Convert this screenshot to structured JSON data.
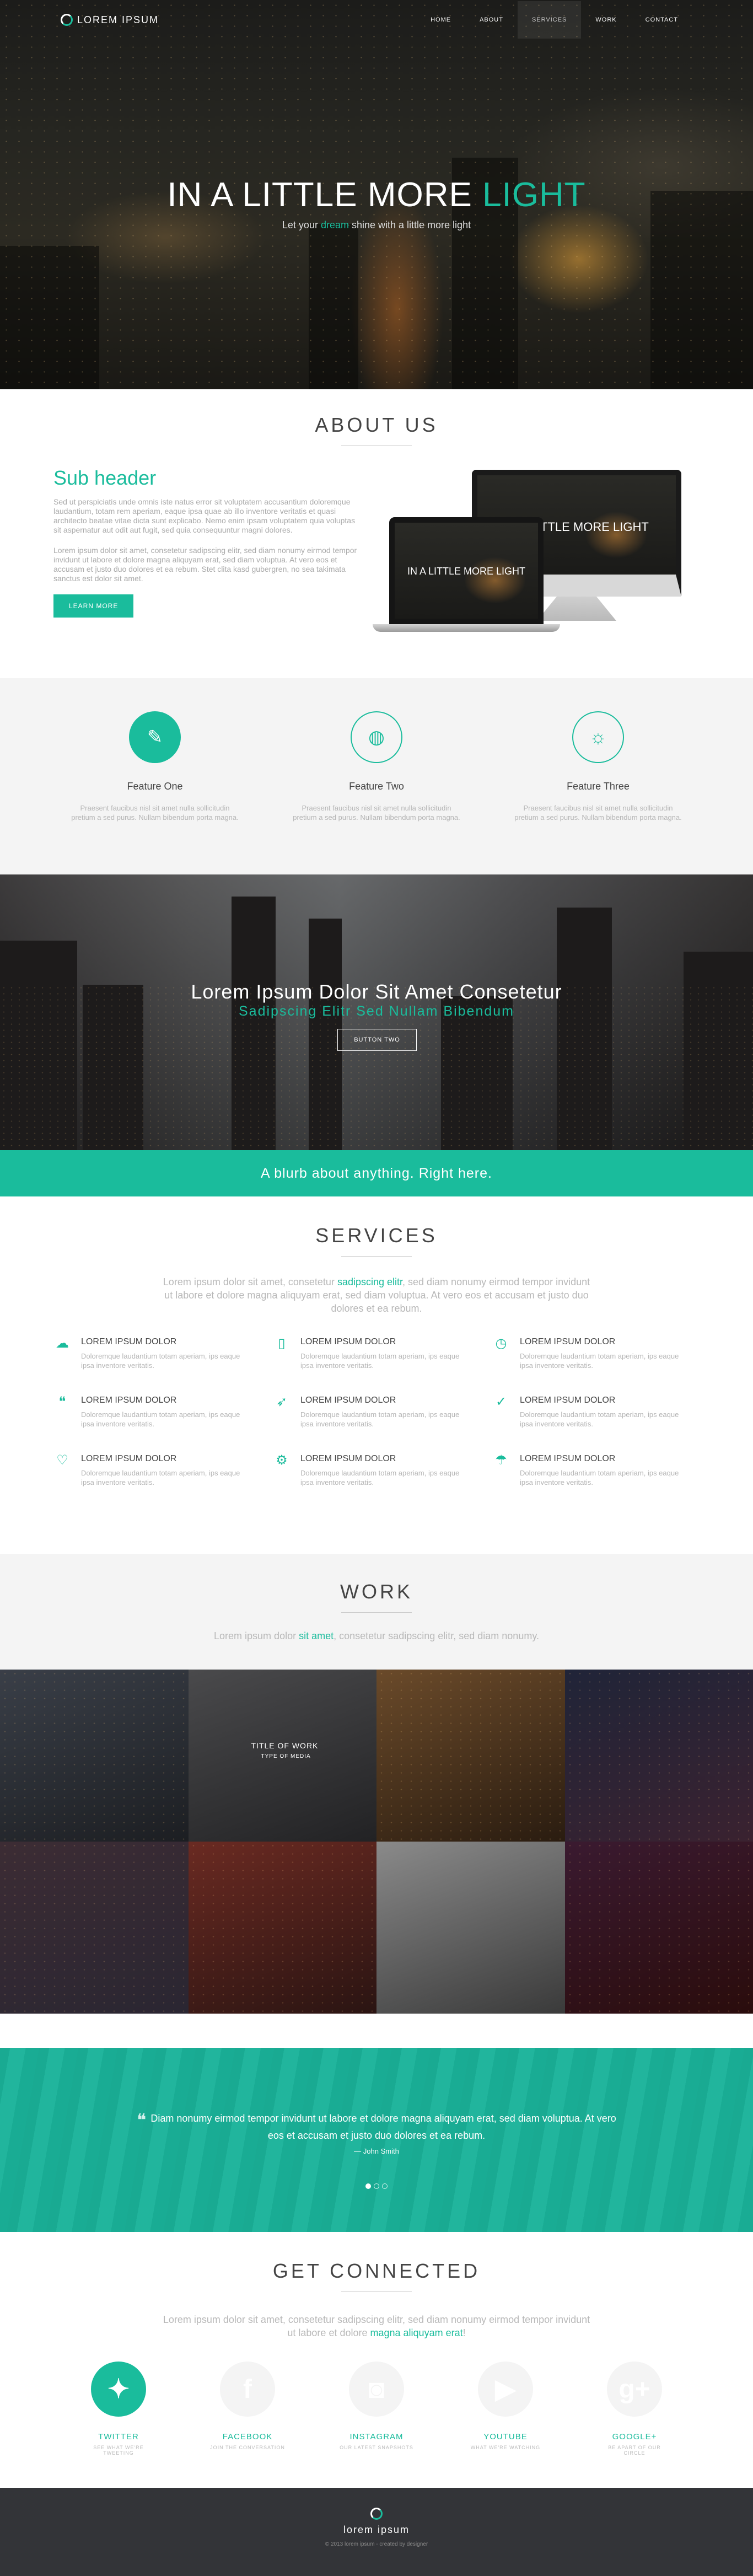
{
  "brand": {
    "name": "LOREM IPSUM",
    "accent": "#1abc9c",
    "dark": "#333438"
  },
  "nav": {
    "items": [
      {
        "label": "HOME"
      },
      {
        "label": "ABOUT"
      },
      {
        "label": "SERVICES"
      },
      {
        "label": "WORK"
      },
      {
        "label": "CONTACT"
      }
    ],
    "active": "SERVICES"
  },
  "hero": {
    "title_main": "IN A LITTLE MORE ",
    "title_accent": "LIGHT",
    "sub_pre": "Let your ",
    "sub_accent": "dream",
    "sub_post": " shine with a little more light"
  },
  "about": {
    "title": "ABOUT US",
    "subheader": "Sub header",
    "p1": "Sed ut perspiciatis unde omnis iste natus error sit voluptatem accusantium doloremque laudantium, totam rem aperiam, eaque ipsa quae ab illo inventore veritatis et quasi architecto beatae vitae dicta sunt explicabo. Nemo enim ipsam voluptatem quia voluptas sit aspernatur aut odit aut fugit, sed quia consequuntur magni dolores.",
    "p2": "Lorem ipsum dolor sit amet, consetetur sadipscing elitr, sed diam nonumy eirmod tempor invidunt ut labore et dolore magna aliquyam erat, sed diam voluptua. At vero eos et accusam et justo duo dolores et ea rebum. Stet clita kasd gubergren, no sea takimata sanctus est dolor sit amet.",
    "button": "LEARN MORE",
    "screen_text": "IN A LITTLE MORE LIGHT"
  },
  "features": [
    {
      "icon": "brush-icon",
      "glyph": "✎",
      "title": "Feature One",
      "text": "Praesent faucibus nisl sit amet nulla sollicitudin pretium a sed purus. Nullam bibendum porta magna."
    },
    {
      "icon": "globe-icon",
      "glyph": "◍",
      "title": "Feature Two",
      "text": "Praesent faucibus nisl sit amet nulla sollicitudin pretium a sed purus. Nullam bibendum porta magna."
    },
    {
      "icon": "lightbulb-icon",
      "glyph": "☼",
      "title": "Feature Three",
      "text": "Praesent faucibus nisl sit amet nulla sollicitudin pretium a sed purus. Nullam bibendum porta magna."
    }
  ],
  "banner": {
    "title": "Lorem Ipsum Dolor Sit Amet Consetetur",
    "subtitle": "Sadipscing Elitr Sed Nullam Bibendum",
    "button": "BUTTON TWO"
  },
  "blurb": "A blurb about anything. Right here.",
  "services": {
    "title": "SERVICES",
    "lead_pre": "Lorem ipsum dolor sit amet, consetetur ",
    "lead_accent": "sadipscing elitr",
    "lead_post": ", sed diam nonumy eirmod tempor invidunt ut labore et dolore magna aliquyam erat, sed diam voluptua. At vero eos et accusam et justo duo dolores et ea rebum.",
    "items": [
      {
        "icon": "cloud-upload-icon",
        "glyph": "☁",
        "title": "LOREM IPSUM DOLOR",
        "text": "Doloremque laudantium totam aperiam, ips eaque ipsa inventore veritatis."
      },
      {
        "icon": "mobile-icon",
        "glyph": "▯",
        "title": "LOREM IPSUM DOLOR",
        "text": "Doloremque laudantium totam aperiam, ips eaque ipsa inventore veritatis."
      },
      {
        "icon": "clock-icon",
        "glyph": "◷",
        "title": "LOREM IPSUM DOLOR",
        "text": "Doloremque laudantium totam aperiam, ips eaque ipsa inventore veritatis."
      },
      {
        "icon": "chat-icon",
        "glyph": "❝",
        "title": "LOREM IPSUM DOLOR",
        "text": "Doloremque laudantium totam aperiam, ips eaque ipsa inventore veritatis."
      },
      {
        "icon": "rocket-icon",
        "glyph": "➶",
        "title": "LOREM IPSUM DOLOR",
        "text": "Doloremque laudantium totam aperiam, ips eaque ipsa inventore veritatis."
      },
      {
        "icon": "thumbs-up-icon",
        "glyph": "✓",
        "title": "LOREM IPSUM DOLOR",
        "text": "Doloremque laudantium totam aperiam, ips eaque ipsa inventore veritatis."
      },
      {
        "icon": "heart-icon",
        "glyph": "♡",
        "title": "LOREM IPSUM DOLOR",
        "text": "Doloremque laudantium totam aperiam, ips eaque ipsa inventore veritatis."
      },
      {
        "icon": "gears-icon",
        "glyph": "⚙",
        "title": "LOREM IPSUM DOLOR",
        "text": "Doloremque laudantium totam aperiam, ips eaque ipsa inventore veritatis."
      },
      {
        "icon": "umbrella-icon",
        "glyph": "☂",
        "title": "LOREM IPSUM DOLOR",
        "text": "Doloremque laudantium totam aperiam, ips eaque ipsa inventore veritatis."
      }
    ]
  },
  "work": {
    "title": "WORK",
    "lead_pre": "Lorem ipsum dolor ",
    "lead_accent": "sit amet",
    "lead_post": ", consetetur sadipscing elitr, sed diam nonumy.",
    "caption_title": "TITLE OF WORK",
    "caption_type": "TYPE OF MEDIA",
    "tiles": [
      {
        "colors": [
          "#3a3f48",
          "#1c1e22"
        ]
      },
      {
        "colors": [
          "#4a4a4c",
          "#222224"
        ]
      },
      {
        "colors": [
          "#6a4a2a",
          "#2a1c10"
        ]
      },
      {
        "colors": [
          "#202438",
          "#3a2230"
        ]
      },
      {
        "colors": [
          "#3c2c34",
          "#2a2632"
        ]
      },
      {
        "colors": [
          "#6a2a22",
          "#2a1412"
        ]
      },
      {
        "colors": [
          "#8a8a8a",
          "#3a3a3a"
        ]
      },
      {
        "colors": [
          "#3a1a30",
          "#2a0c0c"
        ]
      }
    ]
  },
  "testimonial": {
    "quote": "Diam nonumy eirmod tempor invidunt ut labore et dolore magna aliquyam erat, sed diam voluptua. At vero eos et accusam et justo duo dolores et ea rebum.",
    "author": "— John Smith",
    "slides": 3,
    "active_slide": 1
  },
  "connect": {
    "title": "GET CONNECTED",
    "lead_pre": "Lorem ipsum dolor sit amet, consetetur sadipscing elitr, sed diam nonumy eirmod tempor invidunt ut labore et dolore ",
    "lead_accent": "magna aliquyam erat",
    "lead_post": "!",
    "socials": [
      {
        "icon": "twitter-icon",
        "glyph": "✦",
        "name": "TWITTER",
        "tag": "SEE WHAT WE'RE TWEETING",
        "active": true
      },
      {
        "icon": "facebook-icon",
        "glyph": "f",
        "name": "FACEBOOK",
        "tag": "JOIN THE CONVERSATION",
        "active": false
      },
      {
        "icon": "instagram-icon",
        "glyph": "◙",
        "name": "INSTAGRAM",
        "tag": "OUR LATEST SNAPSHOTS",
        "active": false
      },
      {
        "icon": "youtube-icon",
        "glyph": "▶",
        "name": "YOUTUBE",
        "tag": "WHAT WE'RE WATCHING",
        "active": false
      },
      {
        "icon": "googleplus-icon",
        "glyph": "g+",
        "name": "GOOGLE+",
        "tag": "BE APART OF OUR CIRCLE",
        "active": false
      }
    ]
  },
  "footer": {
    "name": "lorem ipsum",
    "copyright": "© 2013 lorem ipsum - created by designer"
  }
}
